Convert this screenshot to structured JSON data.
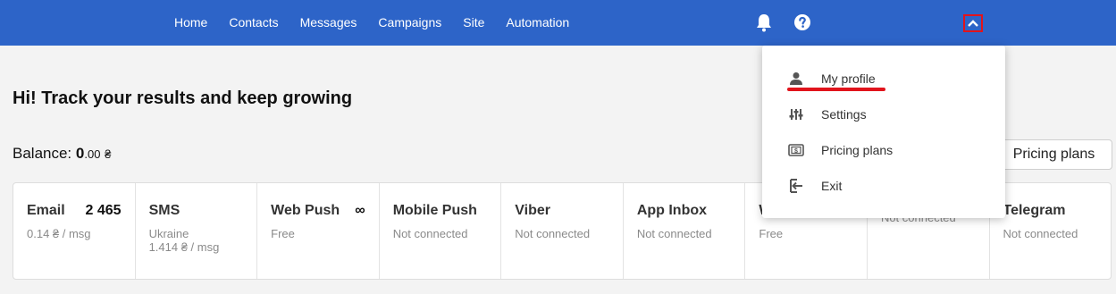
{
  "nav": {
    "items": [
      "Home",
      "Contacts",
      "Messages",
      "Campaigns",
      "Site",
      "Automation"
    ]
  },
  "header_icons": [
    "bell-icon",
    "help-icon",
    "chevron-up-icon"
  ],
  "greeting": "Hi! Track your results and keep growing",
  "balance": {
    "label": "Balance: ",
    "integer": "0",
    "decimal": ".00",
    "currency": "₴"
  },
  "pricing_button": "Pricing plans",
  "channels": [
    {
      "name": "Email",
      "badge": "2 465",
      "sub1": "0.14 ₴ / msg",
      "sub2": ""
    },
    {
      "name": "SMS",
      "badge": "",
      "sub1": "Ukraine",
      "sub2": "1.414 ₴ / msg"
    },
    {
      "name": "Web Push",
      "badge": "∞",
      "sub1": "Free",
      "sub2": ""
    },
    {
      "name": "Mobile Push",
      "badge": "",
      "sub1": "Not connected",
      "sub2": ""
    },
    {
      "name": "Viber",
      "badge": "",
      "sub1": "Not connected",
      "sub2": ""
    },
    {
      "name": "App Inbox",
      "badge": "",
      "sub1": "Not connected",
      "sub2": ""
    },
    {
      "name": "W",
      "badge": "",
      "sub1": "Free",
      "sub2": ""
    },
    {
      "name": "",
      "badge": "",
      "sub1": "Not connected",
      "sub2": ""
    },
    {
      "name": "Telegram",
      "badge": "",
      "sub1": "Not connected",
      "sub2": ""
    }
  ],
  "dropdown": {
    "items": [
      {
        "label": "My profile",
        "icon": "user-icon"
      },
      {
        "label": "Settings",
        "icon": "sliders-icon"
      },
      {
        "label": "Pricing plans",
        "icon": "money-icon"
      },
      {
        "label": "Exit",
        "icon": "exit-icon"
      }
    ]
  },
  "colors": {
    "header": "#2d64c8",
    "highlight": "#e1141c"
  }
}
